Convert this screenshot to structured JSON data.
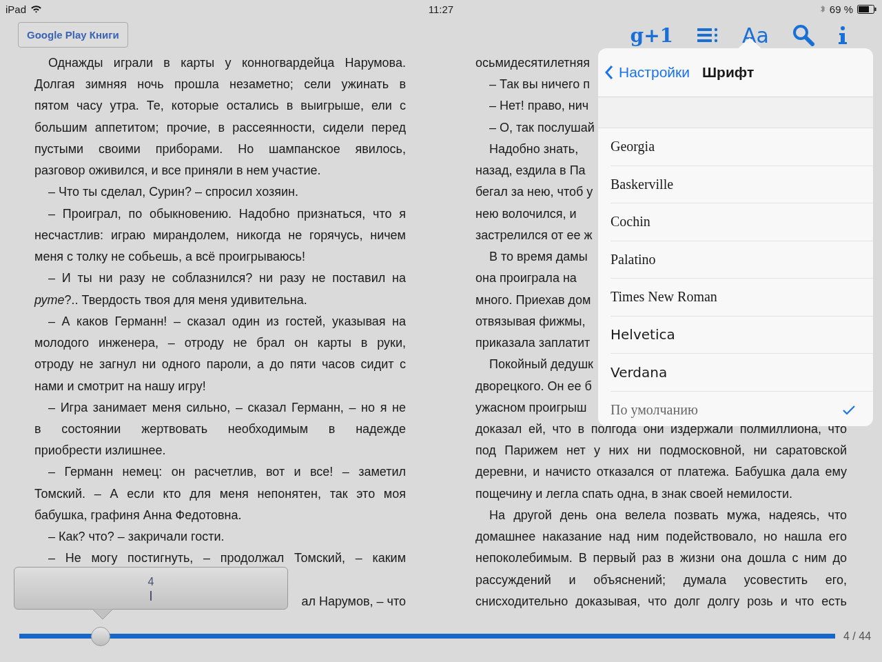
{
  "status_bar": {
    "device": "iPad",
    "time": "11:27",
    "battery": "69 %"
  },
  "toolbar": {
    "back_button": "Google Play Книги",
    "plus_one": "g+1",
    "font_button": "Aa"
  },
  "pages": [
    {
      "lines": [
        {
          "text": "Однажды играли в карты у конногвардейца Нарумова.",
          "indent": true,
          "kind": "justified"
        },
        {
          "text": "Долгая зимняя ночь прошла незаметно; сели ужинать в",
          "indent": false,
          "kind": "justified"
        },
        {
          "text": "пятом часу утра. Те, которые остались в выигрыше, ели с",
          "indent": false,
          "kind": "justified"
        },
        {
          "text": "большим аппетитом; прочие, в рассеянности, сидели перед",
          "indent": false,
          "kind": "justified"
        },
        {
          "text": "пустыми своими приборами. Но шампанское явилось,",
          "indent": false,
          "kind": "justified"
        },
        {
          "text": "разговор оживился, и все приняли в нем участие.",
          "indent": false,
          "kind": "end"
        },
        {
          "text": "– Что ты сделал, Сурин? – спросил хозяин.",
          "indent": true,
          "kind": "end"
        },
        {
          "text": "– Проиграл, по обыкновению. Надобно признаться, что я",
          "indent": true,
          "kind": "justified"
        },
        {
          "text": "несчастлив: играю мирандолем, никогда не горячусь, ничем",
          "indent": false,
          "kind": "justified"
        },
        {
          "text": "меня с толку не собьешь, а всё проигрываюсь!",
          "indent": false,
          "kind": "end"
        },
        {
          "text": "– И ты ни разу не соблазнился? ни разу не поставил на",
          "indent": true,
          "kind": "justified"
        },
        {
          "text": "*руте*?.. Твердость твоя для меня удивительна.",
          "indent": false,
          "kind": "end"
        },
        {
          "text": "– А каков Германн! – сказал один из гостей, указывая на",
          "indent": true,
          "kind": "justified"
        },
        {
          "text": "молодого инженера, – отроду не брал он карты в руки,",
          "indent": false,
          "kind": "justified"
        },
        {
          "text": "отроду не загнул ни одного пароли, а до пяти часов сидит с",
          "indent": false,
          "kind": "justified"
        },
        {
          "text": "нами и смотрит на нашу игру!",
          "indent": false,
          "kind": "end"
        },
        {
          "text": "– Игра занимает меня сильно, – сказал Германн, – но я не",
          "indent": true,
          "kind": "justified"
        },
        {
          "text": "в состоянии жертвовать необходимым в надежде",
          "indent": false,
          "kind": "justified"
        },
        {
          "text": "приобрести излишнее.",
          "indent": false,
          "kind": "end"
        },
        {
          "text": "– Германн немец: он расчетлив, вот и все! – заметил",
          "indent": true,
          "kind": "justified"
        },
        {
          "text": "Томский. – А если кто для меня непонятен, так это моя",
          "indent": false,
          "kind": "justified"
        },
        {
          "text": "бабушка, графиня Анна Федотовна.",
          "indent": false,
          "kind": "end"
        },
        {
          "text": "– Как? что? – закричали гости.",
          "indent": true,
          "kind": "end"
        },
        {
          "text": "– Не могу постигнуть, – продолжал Томский, – каким",
          "indent": true,
          "kind": "justified"
        },
        {
          "kind": "hidden"
        },
        {
          "text": "ал Нарумов, – что",
          "indent": false,
          "kind": "tail"
        }
      ]
    },
    {
      "lines": [
        {
          "text": "осьмидесятилетняя",
          "indent": false,
          "kind": "end"
        },
        {
          "text": "– Так вы ничего п",
          "indent": true,
          "kind": "end"
        },
        {
          "text": "– Нет! право, нич",
          "indent": true,
          "kind": "end"
        },
        {
          "text": "– О, так послушай",
          "indent": true,
          "kind": "end"
        },
        {
          "text": "Надобно знать,",
          "indent": true,
          "kind": "end"
        },
        {
          "text": "назад, ездила в Па",
          "indent": false,
          "kind": "end"
        },
        {
          "text": "бегал за нею, чтоб у",
          "indent": false,
          "kind": "end"
        },
        {
          "text": "нею волочился, и",
          "indent": false,
          "kind": "end"
        },
        {
          "text": "застрелился от ее ж",
          "indent": false,
          "kind": "end"
        },
        {
          "text": "В то время дамы",
          "indent": true,
          "kind": "end"
        },
        {
          "text": "она проиграла на",
          "indent": false,
          "kind": "end"
        },
        {
          "text": "много. Приехав дом",
          "indent": false,
          "kind": "end"
        },
        {
          "text": "отвязывая фижмы,",
          "indent": false,
          "kind": "end"
        },
        {
          "text": "приказала заплатит",
          "indent": false,
          "kind": "end"
        },
        {
          "text": "Покойный дедушк",
          "indent": true,
          "kind": "end"
        },
        {
          "text": "дворецкого. Он ее б",
          "indent": false,
          "kind": "end"
        },
        {
          "text": "ужасном проигрыш",
          "indent": false,
          "kind": "end"
        },
        {
          "text": "доказал ей, что в полгода они издержали полмиллиона, что",
          "indent": false,
          "kind": "justified"
        },
        {
          "text": "под Парижем нет у них ни подмосковной, ни саратовской",
          "indent": false,
          "kind": "justified"
        },
        {
          "text": "деревни, и начисто отказался от платежа. Бабушка дала ему",
          "indent": false,
          "kind": "justified"
        },
        {
          "text": "пощечину и легла спать одна, в знак своей немилости.",
          "indent": false,
          "kind": "end"
        },
        {
          "text": "На другой день она велела позвать мужа, надеясь, что",
          "indent": true,
          "kind": "justified"
        },
        {
          "text": "домашнее наказание над ним подействовало, но нашла его",
          "indent": false,
          "kind": "justified"
        },
        {
          "text": "непоколебимым. В первый раз в жизни она дошла с ним до",
          "indent": false,
          "kind": "justified"
        },
        {
          "text": "рассуждений и объяснений; думала усовестить его,",
          "indent": false,
          "kind": "justified"
        },
        {
          "text": "снисходительно доказывая, что долг долгу розь и что есть",
          "indent": false,
          "kind": "justified"
        }
      ]
    }
  ],
  "font_popover": {
    "back": "Настройки",
    "title": "Шрифт",
    "fonts": [
      {
        "label": "Georgia",
        "kind": "serif",
        "selected": false
      },
      {
        "label": "Baskerville",
        "kind": "serif",
        "selected": false
      },
      {
        "label": "Cochin",
        "kind": "serif",
        "selected": false
      },
      {
        "label": "Palatino",
        "kind": "serif",
        "selected": false
      },
      {
        "label": "Times New Roman",
        "kind": "serif",
        "selected": false
      },
      {
        "label": "Helvetica",
        "kind": "sans",
        "selected": false
      },
      {
        "label": "Verdana",
        "kind": "sans",
        "selected": false
      },
      {
        "label": "По умолчанию",
        "kind": "serif",
        "selected": true
      }
    ]
  },
  "progress": {
    "level": 0.1,
    "tooltip": "4",
    "reading": "4 / 44"
  }
}
